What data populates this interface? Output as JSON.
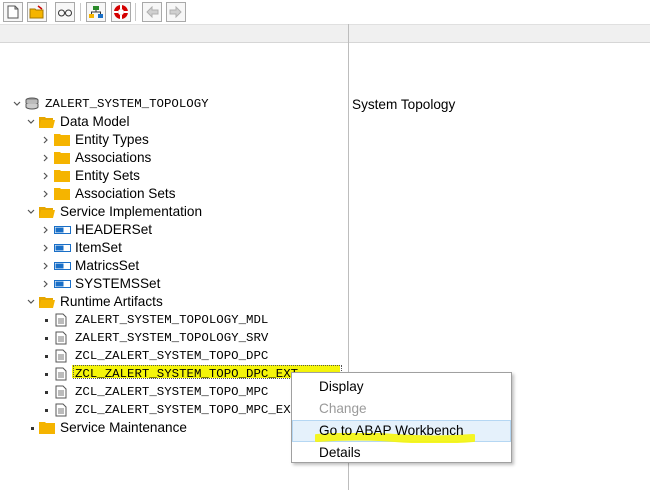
{
  "toolbar": {
    "buttons": [
      "new-document-icon",
      "open-folder-icon",
      "find-glasses-icon",
      "hierarchy-icon",
      "lifebuoy-icon",
      "back-arrow-icon",
      "forward-arrow-icon"
    ]
  },
  "tree": {
    "root": "ZALERT_SYSTEM_TOPOLOGY",
    "data_model": {
      "label": "Data Model",
      "children": [
        "Entity Types",
        "Associations",
        "Entity Sets",
        "Association Sets"
      ]
    },
    "service_implementation": {
      "label": "Service Implementation",
      "children": [
        "HEADERSet",
        "ItemSet",
        "MatricsSet",
        "SYSTEMSSet"
      ]
    },
    "runtime_artifacts": {
      "label": "Runtime Artifacts",
      "children": [
        "ZALERT_SYSTEM_TOPOLOGY_MDL",
        "ZALERT_SYSTEM_TOPOLOGY_SRV",
        "ZCL_ZALERT_SYSTEM_TOPO_DPC",
        "ZCL_ZALERT_SYSTEM_TOPO_DPC_EXT",
        "ZCL_ZALERT_SYSTEM_TOPO_MPC",
        "ZCL_ZALERT_SYSTEM_TOPO_MPC_EXT"
      ]
    },
    "service_maintenance": "Service Maintenance"
  },
  "detail": {
    "title": "System Topology"
  },
  "context_menu": {
    "items": [
      {
        "label": "Display",
        "enabled": true
      },
      {
        "label": "Change",
        "enabled": false
      },
      {
        "label": "Go to ABAP Workbench",
        "enabled": true
      },
      {
        "label": "Details",
        "enabled": true
      }
    ]
  },
  "colors": {
    "folder": "#f5b400",
    "highlight": "#f5f50a",
    "menu_hover": "#e5f1fb",
    "entity_icon": "#1a6fc7"
  }
}
